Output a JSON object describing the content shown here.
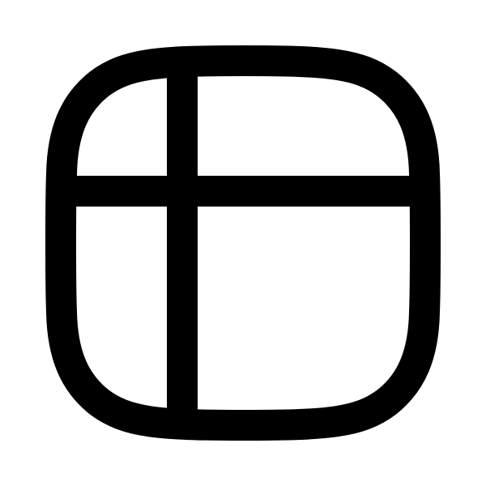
{
  "icon": {
    "name": "table-layout-icon",
    "stroke_color": "#000000",
    "background_color": "#ffffff"
  }
}
